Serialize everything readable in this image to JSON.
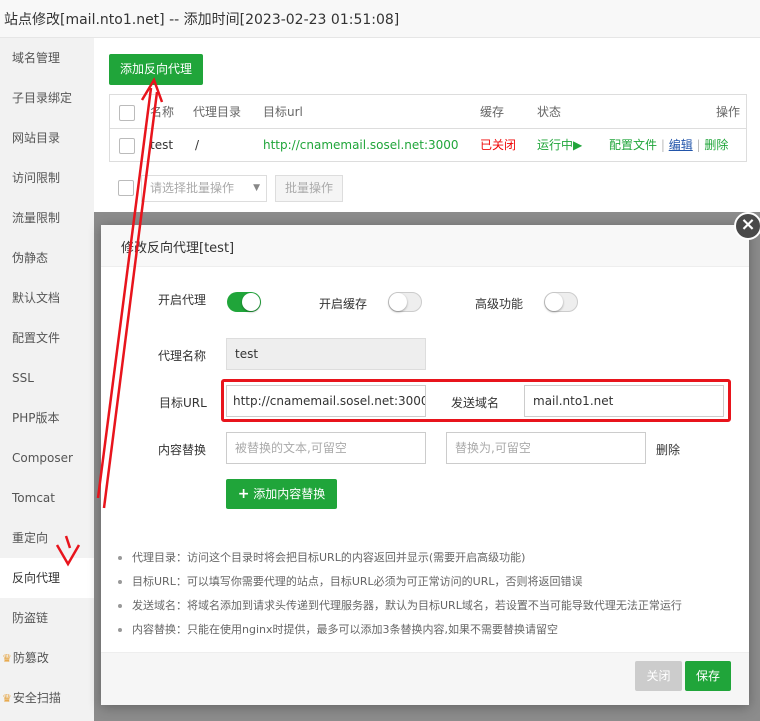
{
  "window": {
    "title": "站点修改[mail.nto1.net] -- 添加时间[2023-02-23 01:51:08]"
  },
  "sidebar": {
    "items": [
      {
        "label": "域名管理"
      },
      {
        "label": "子目录绑定"
      },
      {
        "label": "网站目录"
      },
      {
        "label": "访问限制"
      },
      {
        "label": "流量限制"
      },
      {
        "label": "伪静态"
      },
      {
        "label": "默认文档"
      },
      {
        "label": "配置文件"
      },
      {
        "label": "SSL"
      },
      {
        "label": "PHP版本"
      },
      {
        "label": "Composer"
      },
      {
        "label": "Tomcat"
      },
      {
        "label": "重定向"
      },
      {
        "label": "反向代理",
        "active": true
      },
      {
        "label": "防盗链"
      },
      {
        "label": "防篡改",
        "premium": true
      },
      {
        "label": "安全扫描",
        "premium": true
      }
    ]
  },
  "main": {
    "add_button": "添加反向代理",
    "table": {
      "headers": [
        "名称",
        "代理目录",
        "目标url",
        "缓存",
        "状态",
        "操作"
      ],
      "rows": [
        {
          "name": "test",
          "dir": "/",
          "target": "http://cnamemail.sosel.net:3000",
          "cache": "已关闭",
          "status": "运行中▶",
          "actions": [
            "配置文件",
            "编辑",
            "删除"
          ]
        }
      ]
    },
    "batch_select_placeholder": "请选择批量操作",
    "batch_button": "批量操作"
  },
  "modal": {
    "title": "修改反向代理[test]",
    "close_glyph": "×",
    "enable_proxy_label": "开启代理",
    "enable_proxy": true,
    "enable_cache_label": "开启缓存",
    "enable_cache": false,
    "advanced_label": "高级功能",
    "advanced": false,
    "proxy_name_label": "代理名称",
    "proxy_name_value": "test",
    "target_url_label": "目标URL",
    "target_url_value": "http://cnamemail.sosel.net:3000",
    "send_domain_label": "发送域名",
    "send_domain_value": "mail.nto1.net",
    "content_replace_label": "内容替换",
    "replace_from_placeholder": "被替换的文本,可留空",
    "replace_to_placeholder": "替换为,可留空",
    "replace_delete": "删除",
    "add_replace_button": "添加内容替换",
    "notes": [
      "代理目录：访问这个目录时将会把目标URL的内容返回并显示(需要开启高级功能)",
      "目标URL：可以填写你需要代理的站点，目标URL必须为可正常访问的URL，否则将返回错误",
      "发送域名：将域名添加到请求头传递到代理服务器，默认为目标URL域名，若设置不当可能导致代理无法正常运行",
      "内容替换：只能在使用nginx时提供，最多可以添加3条替换内容,如果不需要替换请留空"
    ],
    "close_button": "关闭",
    "save_button": "保存"
  },
  "colors": {
    "accent": "#20a53a",
    "danger": "#ef0808",
    "annotation": "#e8141c"
  }
}
